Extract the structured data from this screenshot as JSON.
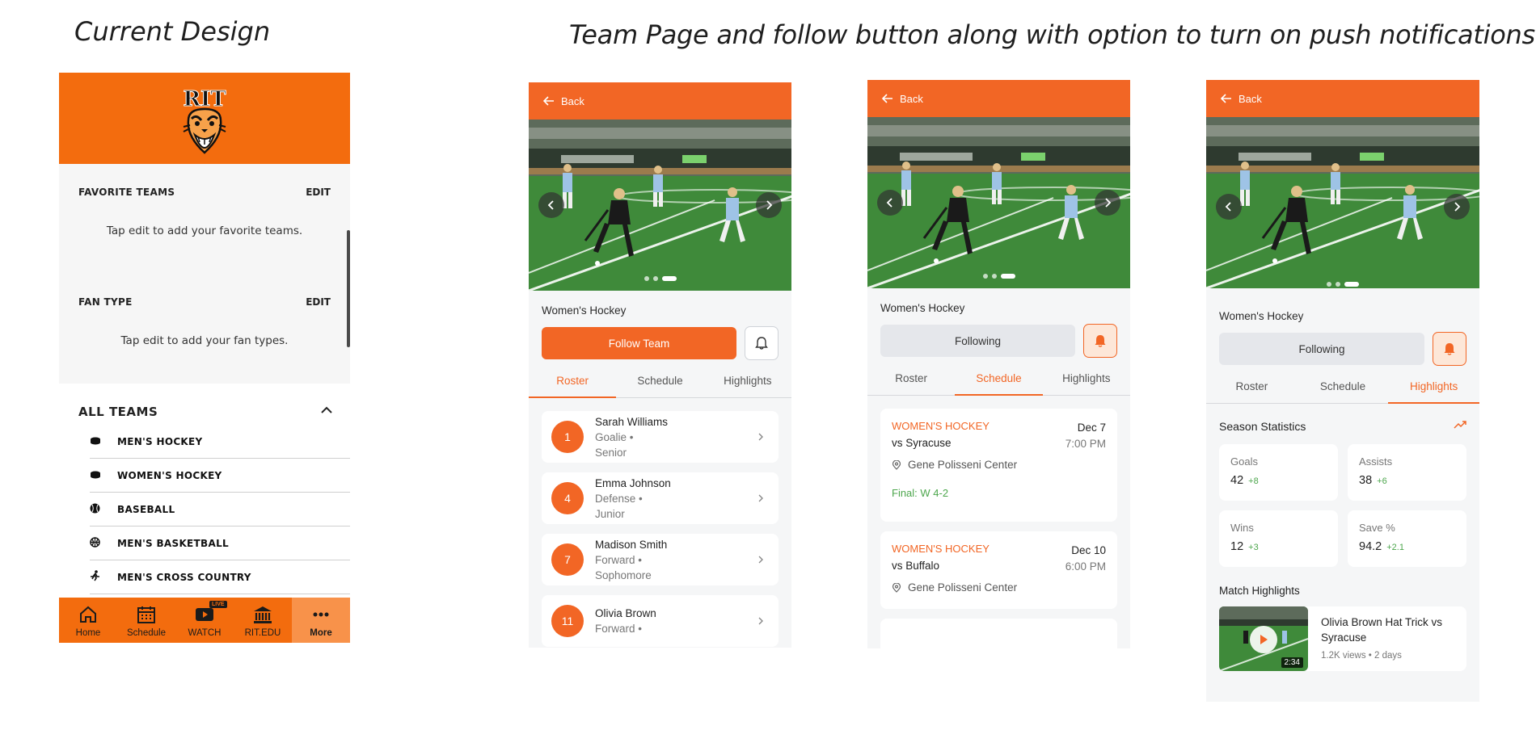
{
  "headings": {
    "current": "Current Design",
    "team": "Team Page and follow button along with option to turn on push notifications."
  },
  "current_design": {
    "logo_text": "RIT",
    "favorite_teams": {
      "title": "FAVORITE TEAMS",
      "edit": "EDIT",
      "hint": "Tap edit to add your favorite teams."
    },
    "fan_type": {
      "title": "FAN TYPE",
      "edit": "EDIT",
      "hint": "Tap edit to add your fan types."
    },
    "all_teams": {
      "title": "ALL TEAMS",
      "items": [
        {
          "label": "MEN'S HOCKEY",
          "icon": "hockey-puck-icon"
        },
        {
          "label": "WOMEN'S HOCKEY",
          "icon": "hockey-puck-icon"
        },
        {
          "label": "BASEBALL",
          "icon": "baseball-icon"
        },
        {
          "label": "MEN'S BASKETBALL",
          "icon": "basketball-icon"
        },
        {
          "label": "MEN'S CROSS COUNTRY",
          "icon": "runner-icon"
        }
      ]
    },
    "tabbar": [
      {
        "label": "Home",
        "icon": "home-icon"
      },
      {
        "label": "Schedule",
        "icon": "calendar-icon"
      },
      {
        "label": "WATCH",
        "icon": "play-icon",
        "badge": "LIVE"
      },
      {
        "label": "RIT.EDU",
        "icon": "building-icon"
      },
      {
        "label": "More",
        "icon": "more-icon",
        "active": true
      }
    ],
    "colors": {
      "brand": "#f36c0e"
    }
  },
  "team_pages": [
    {
      "back": "Back",
      "team": "Women's Hockey",
      "follow_label": "Follow Team",
      "bell_active": false,
      "tabs": [
        "Roster",
        "Schedule",
        "Highlights"
      ],
      "selected_tab": 0,
      "roster": [
        {
          "number": "1",
          "name": "Sarah Williams",
          "position": "Goalie •",
          "year": "Senior"
        },
        {
          "number": "4",
          "name": "Emma Johnson",
          "position": "Defense •",
          "year": "Junior"
        },
        {
          "number": "7",
          "name": "Madison Smith",
          "position": "Forward •",
          "year": "Sophomore"
        },
        {
          "number": "11",
          "name": "Olivia Brown",
          "position": "Forward •",
          "year": ""
        }
      ]
    },
    {
      "back": "Back",
      "team": "Women's Hockey",
      "follow_label": "Following",
      "bell_active": true,
      "tabs": [
        "Roster",
        "Schedule",
        "Highlights"
      ],
      "selected_tab": 1,
      "games": [
        {
          "sport": "WOMEN'S HOCKEY",
          "opponent": "vs Syracuse",
          "date": "Dec 7",
          "time": "7:00 PM",
          "venue": "Gene Polisseni Center",
          "result": "Final: W 4-2"
        },
        {
          "sport": "WOMEN'S HOCKEY",
          "opponent": "vs Buffalo",
          "date": "Dec 10",
          "time": "6:00 PM",
          "venue": "Gene Polisseni Center",
          "result": ""
        }
      ]
    },
    {
      "back": "Back",
      "team": "Women's Hockey",
      "follow_label": "Following",
      "bell_active": true,
      "tabs": [
        "Roster",
        "Schedule",
        "Highlights"
      ],
      "selected_tab": 2,
      "season_title": "Season Statistics",
      "stats": [
        {
          "label": "Goals",
          "value": "42",
          "delta": "+8"
        },
        {
          "label": "Assists",
          "value": "38",
          "delta": "+6"
        },
        {
          "label": "Wins",
          "value": "12",
          "delta": "+3"
        },
        {
          "label": "Save %",
          "value": "94.2",
          "delta": "+2.1"
        }
      ],
      "match_highlights_title": "Match Highlights",
      "highlight": {
        "title": "Olivia Brown Hat Trick vs Syracuse",
        "meta": "1.2K views • 2 days",
        "duration": "2:34"
      }
    }
  ],
  "colors": {
    "accent": "#f26625",
    "positive": "#4ca64c"
  }
}
